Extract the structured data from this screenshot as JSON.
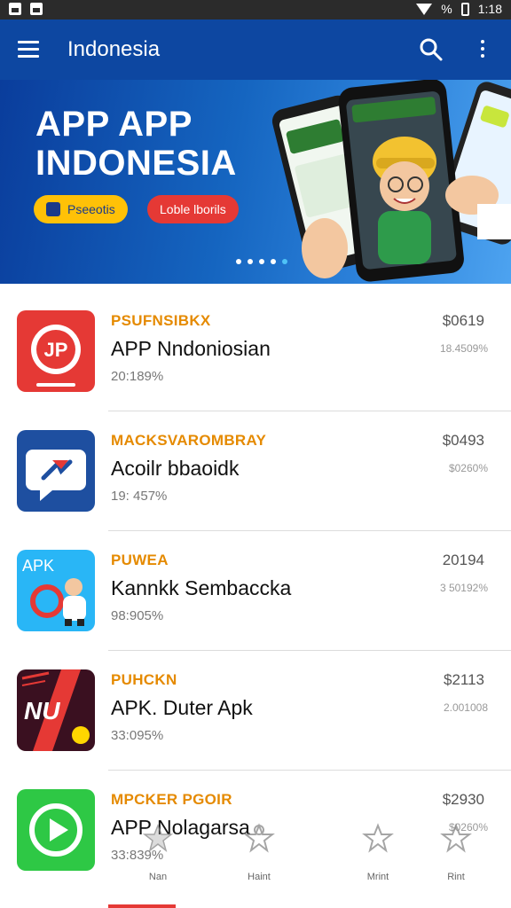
{
  "status_bar": {
    "time": "1:18",
    "battery_symbol": "%"
  },
  "appbar": {
    "title": "Indonesia",
    "background": "#0d47a1"
  },
  "banner": {
    "title_line1": "APP APP",
    "title_line2": "INDONESIA",
    "chip_yellow": "Pseeotis",
    "chip_red": "Loble lborils",
    "slide_count": 5,
    "active_slide": 4
  },
  "apps": [
    {
      "category": "PSUFNSIBKX",
      "name": "APP Nndoniosian",
      "meta": "20:189%",
      "price": "$0619",
      "sub": "18.4509%",
      "icon": "jp-red-icon",
      "icon_text": "JP",
      "icon_color": "#e53935"
    },
    {
      "category": "MACKSVAROMBRAY",
      "name": "Acoilr bbaoidk",
      "meta": "19: 457%",
      "price": "$0493",
      "sub": "$0260%",
      "icon": "chat-bubble-icon",
      "icon_text": "",
      "icon_color": "#1e4fa0"
    },
    {
      "category": "PUWEA",
      "name": "Kannkk Sembaccka",
      "meta": "98:905%",
      "price": "20194",
      "sub": "3 50192%",
      "icon": "apk-cartoon-icon",
      "icon_text": "APK",
      "icon_color": "#29b6f6"
    },
    {
      "category": "PUHCKN",
      "name": "APK. Duter Apk",
      "meta": "33:095%",
      "price": "$2113",
      "sub": "2.001008",
      "icon": "nu-dark-icon",
      "icon_text": "NU",
      "icon_color": "#3a1020"
    },
    {
      "category": "MPCKER PGOIR",
      "name": "APP Nolagarsa",
      "meta": "33:839%",
      "price": "$2930",
      "sub": "$0260%",
      "icon": "play-green-icon",
      "icon_text": "",
      "icon_color": "#2ec845"
    }
  ],
  "bottom_nav": [
    {
      "label": "Nan",
      "icon": "star-icon"
    },
    {
      "label": "Haint",
      "icon": "bookmark-icon"
    },
    {
      "label": "Mrint",
      "icon": "star-icon"
    },
    {
      "label": "Rint",
      "icon": "star-icon"
    }
  ]
}
